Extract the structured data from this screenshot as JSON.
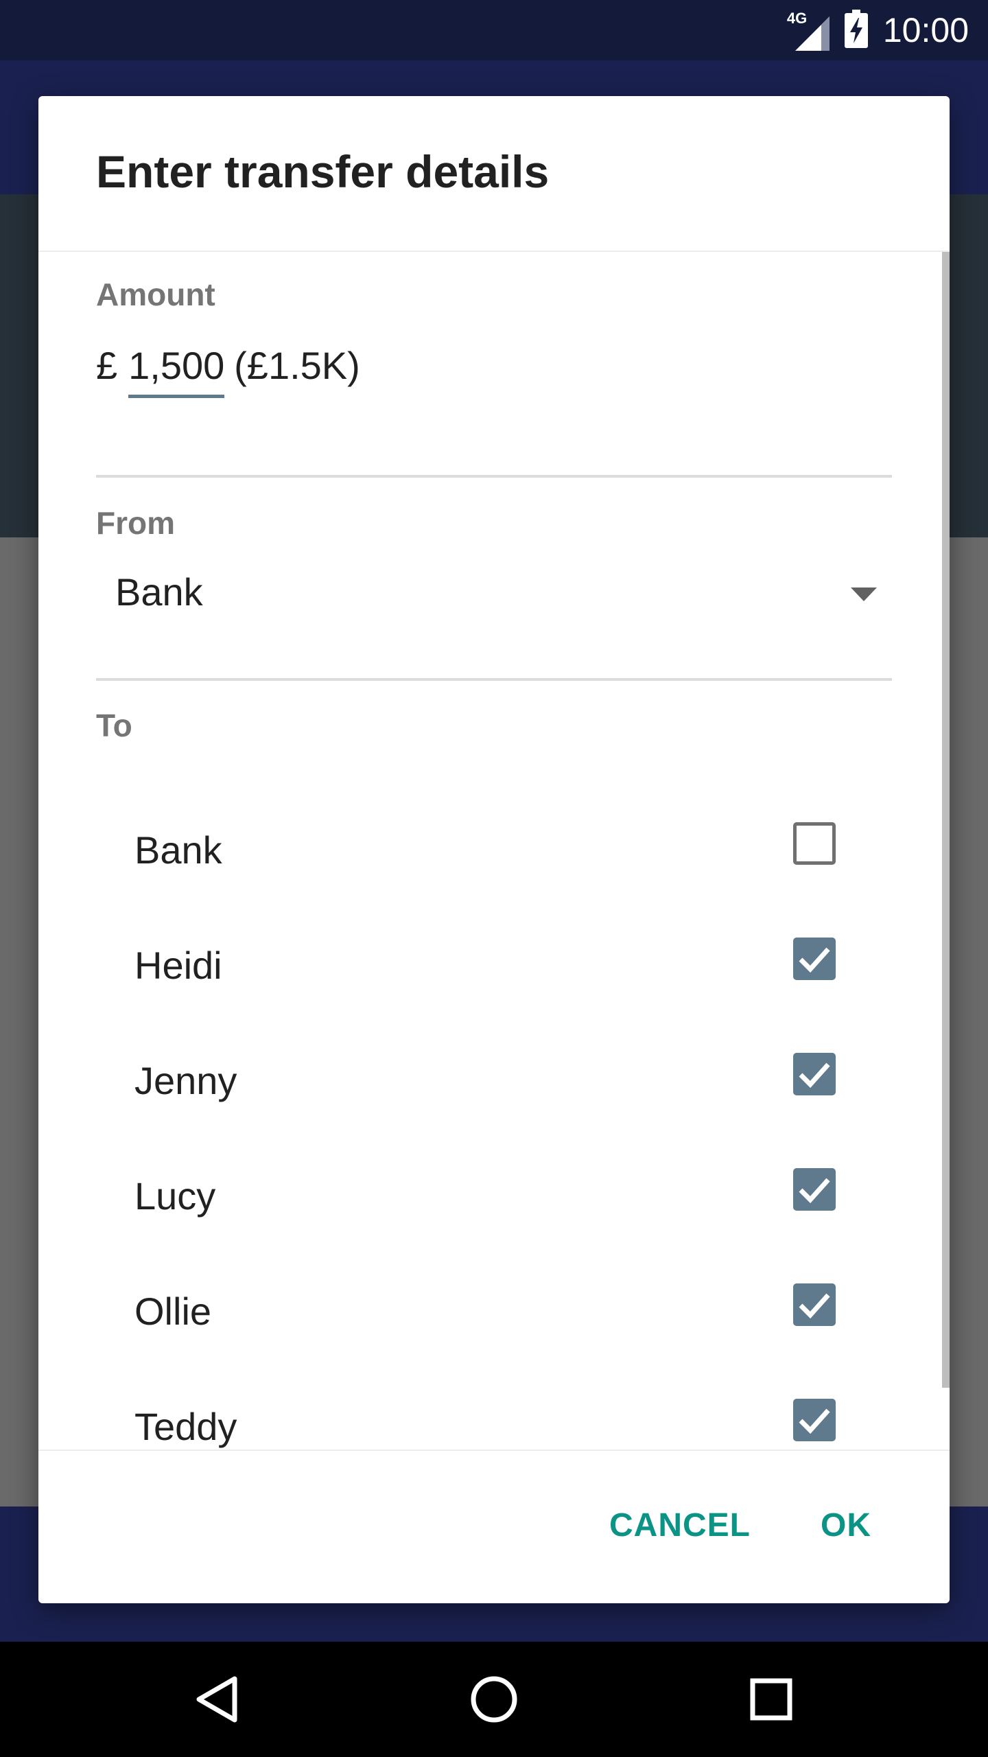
{
  "status_bar": {
    "network": "4G",
    "time": "10:00"
  },
  "dialog": {
    "title": "Enter transfer details",
    "amount": {
      "label": "Amount",
      "currency": "£",
      "value": "1,500",
      "short_form": "(£1.5K)"
    },
    "from": {
      "label": "From",
      "selected": "Bank"
    },
    "to": {
      "label": "To",
      "items": [
        {
          "name": "Bank",
          "checked": false
        },
        {
          "name": "Heidi",
          "checked": true
        },
        {
          "name": "Jenny",
          "checked": true
        },
        {
          "name": "Lucy",
          "checked": true
        },
        {
          "name": "Ollie",
          "checked": true
        },
        {
          "name": "Teddy",
          "checked": true
        }
      ]
    },
    "actions": {
      "cancel": "CANCEL",
      "ok": "OK"
    }
  },
  "colors": {
    "accent": "#0b9486",
    "checkbox": "#5f7a8c",
    "status_bar": "#131a3a",
    "app_bar": "#1a2150"
  },
  "icons": {
    "nav_back": "back-triangle-icon",
    "nav_home": "home-circle-icon",
    "nav_recents": "recents-square-icon"
  }
}
